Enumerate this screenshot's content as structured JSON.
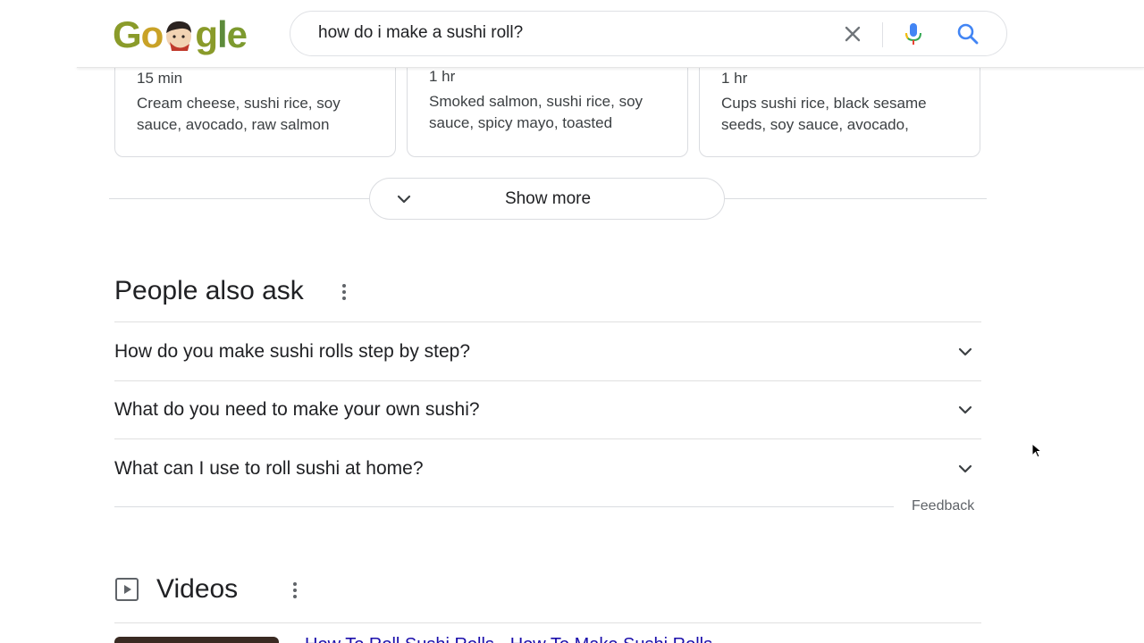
{
  "search": {
    "query": "how do i make a sushi roll?"
  },
  "icons": {
    "clear": "close-icon",
    "mic": "microphone-icon",
    "search": "search-icon"
  },
  "recipe_cards": [
    {
      "time": "15 min",
      "ingredients": "Cream cheese, sushi rice, soy sauce, avocado, raw salmon"
    },
    {
      "time": "1 hr",
      "ingredients": "Smoked salmon, sushi rice, soy sauce, spicy mayo, toasted"
    },
    {
      "time": "1 hr",
      "ingredients": "Cups sushi rice, black sesame seeds, soy sauce, avocado,"
    }
  ],
  "show_more": {
    "label": "Show more"
  },
  "people_also_ask": {
    "title": "People also ask",
    "questions": [
      "How do you make sushi rolls step by step?",
      "What do you need to make your own sushi?",
      "What can I use to roll sushi at home?"
    ],
    "feedback": "Feedback"
  },
  "videos": {
    "title": "Videos",
    "first_link": "How To Roll Sushi Rolls - How To Make Sushi Rolls"
  },
  "colors": {
    "link": "#1a0dab",
    "mic_blue": "#4285f4",
    "mic_red": "#ea4335",
    "search_blue": "#4285f4"
  }
}
